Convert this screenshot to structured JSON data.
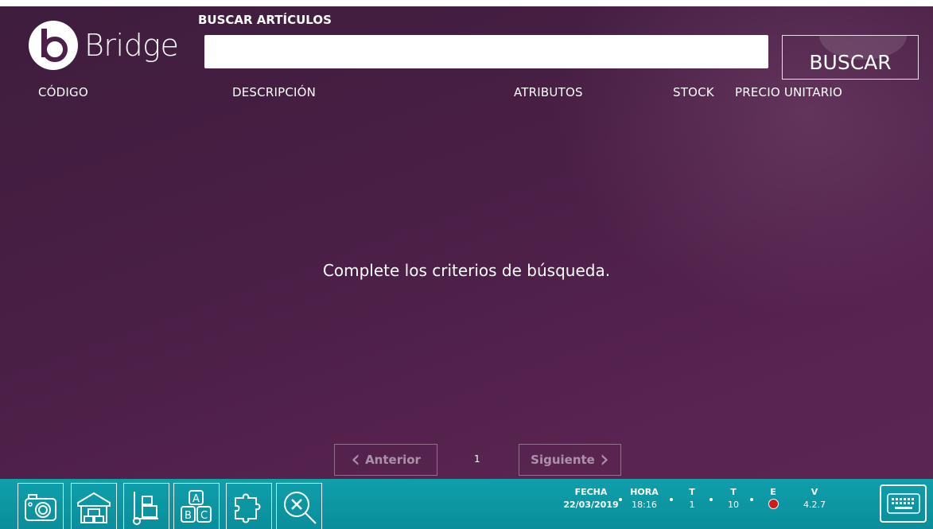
{
  "app": {
    "brand": "Bridge"
  },
  "search": {
    "label": "BUSCAR ARTÍCULOS",
    "value": "",
    "placeholder": "",
    "button_label": "BUSCAR"
  },
  "columns": [
    "CÓDIGO",
    "DESCRIPCIÓN",
    "ATRIBUTOS",
    "STOCK",
    "PRECIO UNITARIO"
  ],
  "results": {
    "rows": [],
    "empty_message": "Complete los criterios de búsqueda."
  },
  "pagination": {
    "prev_label": "Anterior",
    "next_label": "Siguiente",
    "current_page": "1"
  },
  "toolbar": {
    "tools": [
      "camera-icon",
      "warehouse-icon",
      "hand-truck-icon",
      "abc-blocks-icon",
      "puzzle-icon",
      "clear-search-icon"
    ]
  },
  "status": {
    "fecha_label": "FECHA",
    "fecha_value": "22/03/2019",
    "hora_label": "HORA",
    "hora_value": "18:16",
    "t1_label": "T",
    "t1_value": "1",
    "t2_label": "T",
    "t2_value": "10",
    "e_label": "E",
    "v_label": "V",
    "v_value": "4.2.7"
  },
  "colors": {
    "background": "#4b1f47",
    "footer": "#0f9fab",
    "status_error": "#d01a1a"
  }
}
